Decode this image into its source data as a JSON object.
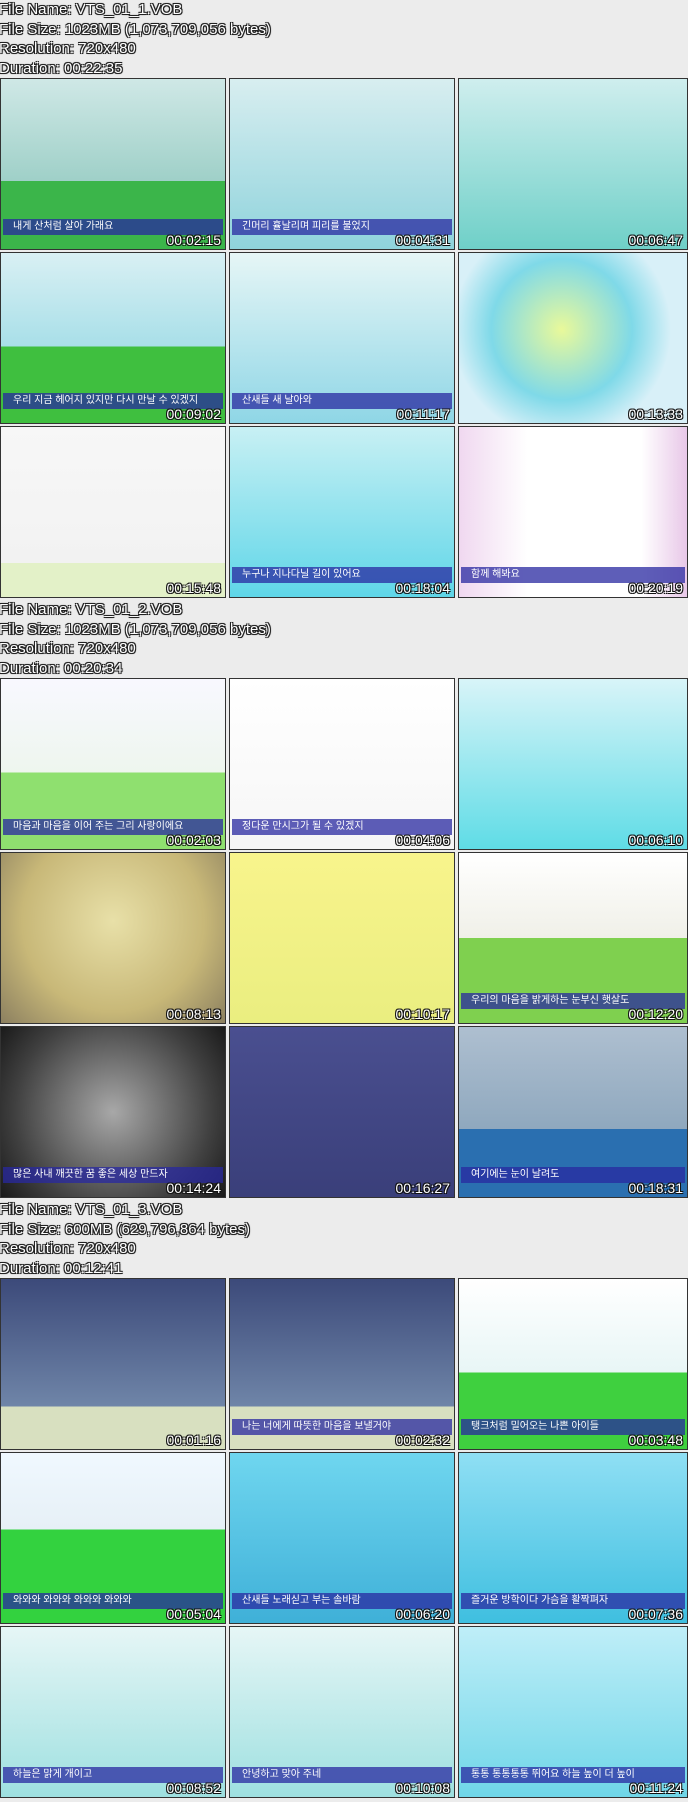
{
  "files": [
    {
      "name_label": "File Name: VTS_01_1.VOB",
      "size_label": "File Size: 1023MB (1,073,709,056 bytes)",
      "resolution_label": "Resolution: 720x480",
      "duration_label": "Duration: 00:22:35",
      "thumbs": [
        {
          "time": "00:02:15",
          "subtitle": "내게 산처럼 살아 가래요",
          "bg": "linear-gradient(#cfe8e6,#9fd0c8 60%,#3bb54a 60%)"
        },
        {
          "time": "00:04:31",
          "subtitle": "긴머리 휼날리며 피리를 불었지",
          "bg": "linear-gradient(#d8eef0,#8fd3dc)"
        },
        {
          "time": "00:06:47",
          "subtitle": "",
          "bg": "linear-gradient(#cfeeee,#6fd0c8)"
        },
        {
          "time": "00:09:02",
          "subtitle": "우리 지금 헤어지 있지만 다시 만날 수 있겠지",
          "bg": "linear-gradient(#d9f0f4,#a8dfe8 55%,#3fbf3f 55%)"
        },
        {
          "time": "00:11:17",
          "subtitle": "산새들 새 날아와",
          "bg": "linear-gradient(#e6f6f6,#8fd6e6)"
        },
        {
          "time": "00:13:33",
          "subtitle": "",
          "bg": "radial-gradient(circle at 45% 45%,#e9f99a,#7fd9e8 45%,#d8f0f8 70%)"
        },
        {
          "time": "00:15:48",
          "subtitle": "",
          "bg": "linear-gradient(#f7f7f7,#f2f2f2 80%,#e3f1c8 80%)"
        },
        {
          "time": "00:18:04",
          "subtitle": "누구나 지나다닐 길이 있어요",
          "bg": "linear-gradient(#c8f0f4,#5fd6e8)"
        },
        {
          "time": "00:20:19",
          "subtitle": "함께 해봐요",
          "bg": "linear-gradient(90deg,#f0d8f0,#ffffff 30%,#ffffff 80%,#e8c8e8)"
        }
      ]
    },
    {
      "name_label": "File Name: VTS_01_2.VOB",
      "size_label": "File Size: 1023MB (1,073,709,056 bytes)",
      "resolution_label": "Resolution: 720x480",
      "duration_label": "Duration: 00:20:34",
      "thumbs": [
        {
          "time": "00:02:03",
          "subtitle": "마음과 마음을 이어 주는 그리 사랑이에요",
          "bg": "linear-gradient(#f8f8ff,#eef6ee 55%,#8fe06f 55%)"
        },
        {
          "time": "00:04:06",
          "subtitle": "정다운 만시그가 될 수 있겠지",
          "bg": "linear-gradient(#ffffff,#f6f6f6)"
        },
        {
          "time": "00:06:10",
          "subtitle": "",
          "bg": "linear-gradient(#d8f4f8,#5fdce6)"
        },
        {
          "time": "00:08:13",
          "subtitle": "",
          "bg": "radial-gradient(circle at 50% 40%,#e8e0a8,#c8b878 60%,#8c8060)"
        },
        {
          "time": "00:10:17",
          "subtitle": "",
          "bg": "linear-gradient(#f8f48c,#eaee80)"
        },
        {
          "time": "00:12:20",
          "subtitle": "우리의 마음을 밝게하는 눈부신 햇살도",
          "bg": "linear-gradient(#ffffff,#f0f0e8 50%,#7fd04f 50%)"
        },
        {
          "time": "00:14:24",
          "subtitle": "많은 사내 깨끗한 꿈 좋은 세상 만드자",
          "bg": "radial-gradient(circle at 50% 50%,#a8a8a8,#404040 70%,#1a1a1a)"
        },
        {
          "time": "00:16:27",
          "subtitle": "",
          "bg": "linear-gradient(#4a4f90,#3a3f7a)"
        },
        {
          "time": "00:18:31",
          "subtitle": "여기에는 눈이 날려도",
          "bg": "linear-gradient(#aebfd0,#8fa8be 60%,#2a6fb0 60%)"
        }
      ]
    },
    {
      "name_label": "File Name: VTS_01_3.VOB",
      "size_label": "File Size: 600MB (629,796,864 bytes)",
      "resolution_label": "Resolution: 720x480",
      "duration_label": "Duration: 00:12:41",
      "thumbs": [
        {
          "time": "00:01:16",
          "subtitle": "",
          "bg": "linear-gradient(#3c4a7a,#6f85a8 75%,#d8e0c0 75%)"
        },
        {
          "time": "00:02:32",
          "subtitle": "나는 너에게 따뜻한 마음을 보낼거야",
          "bg": "linear-gradient(#3c4a7a,#6f85a8 75%,#d8e0c0 75%)"
        },
        {
          "time": "00:03:48",
          "subtitle": "탱크처럼 밀어오는 나쁜 아이들",
          "bg": "linear-gradient(#ffffff,#e8f6f6 55%,#3fd03f 55%)"
        },
        {
          "time": "00:05:04",
          "subtitle": "와와와 와와와 와와와 와와와",
          "bg": "linear-gradient(#f0f8ff,#e6f0f6 45%,#33d23f 45%)"
        },
        {
          "time": "00:06:20",
          "subtitle": "산새들 노래싣고 부는 솔바람",
          "bg": "linear-gradient(#6fd6ef,#3fb0d8)"
        },
        {
          "time": "00:07:36",
          "subtitle": "즐거운 방학이다 가슴을 활짝펴자",
          "bg": "linear-gradient(#8fdff4,#3fbfe0)"
        },
        {
          "time": "00:08:52",
          "subtitle": "하늘은 맑게 개이고",
          "bg": "linear-gradient(#e6f6f6,#9ee0e0)"
        },
        {
          "time": "00:10:08",
          "subtitle": "안녕하고 맞아 주네",
          "bg": "linear-gradient(#e6f6f6,#9ee0e0)"
        },
        {
          "time": "00:11:24",
          "subtitle": "통통 통통통통 뛰어요 하늘 높이 더 높이",
          "bg": "linear-gradient(#bfeef8,#6fd6e8)"
        }
      ]
    }
  ]
}
